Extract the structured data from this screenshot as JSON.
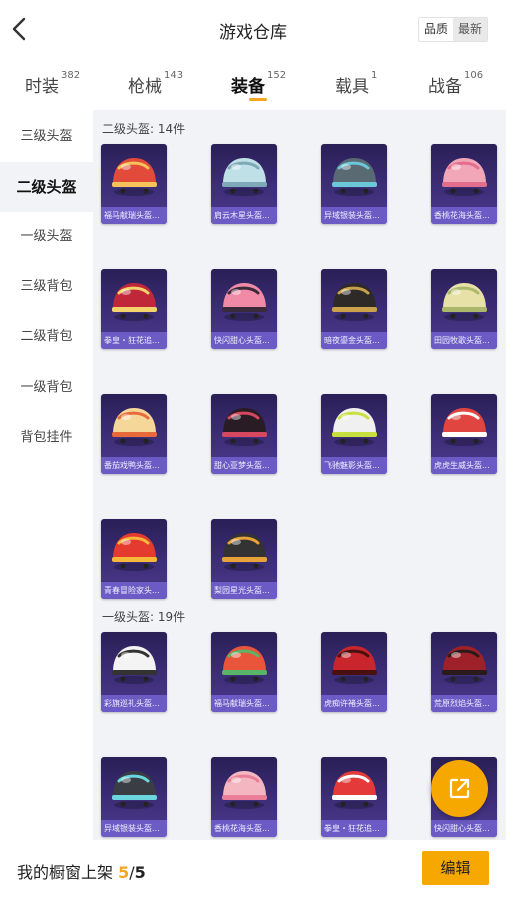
{
  "header": {
    "title": "游戏仓库",
    "sort_quality": "品质",
    "sort_newest": "最新"
  },
  "tabs": [
    {
      "label": "时装",
      "count": "382"
    },
    {
      "label": "枪械",
      "count": "143"
    },
    {
      "label": "装备",
      "count": "152"
    },
    {
      "label": "载具",
      "count": "1"
    },
    {
      "label": "战备",
      "count": "106"
    }
  ],
  "sidebar": [
    "三级头盔",
    "二级头盔",
    "一级头盔",
    "三级背包",
    "二级背包",
    "一级背包",
    "背包挂件"
  ],
  "sections": [
    {
      "title": "二级头盔: 14件",
      "items": [
        {
          "name": "福马献瑞头盔...",
          "color": "#e24a3a",
          "accent": "#f6c35b"
        },
        {
          "name": "肩云木星头盔...",
          "color": "#bfe0e6",
          "accent": "#7fa9b8"
        },
        {
          "name": "异域银装头盔...",
          "color": "#5a6a73",
          "accent": "#6cc7d8"
        },
        {
          "name": "香桃花海头盔...",
          "color": "#f2a7b8",
          "accent": "#e26d8c"
        },
        {
          "name": "拳皇・狂花追...",
          "color": "#c0283a",
          "accent": "#f3d36b"
        },
        {
          "name": "快闪甜心头盔...",
          "color": "#f08aa6",
          "accent": "#3a2a3a"
        },
        {
          "name": "暗夜鎏金头盔...",
          "color": "#2e2a28",
          "accent": "#c9a24b"
        },
        {
          "name": "田园牧歌头盔...",
          "color": "#e7e1a8",
          "accent": "#a9b86b"
        },
        {
          "name": "番茄戏鸭头盔...",
          "color": "#f6d79a",
          "accent": "#e86a3a"
        },
        {
          "name": "甜心亚梦头盔...",
          "color": "#2a1c24",
          "accent": "#d6485f"
        },
        {
          "name": "飞驰魅影头盔...",
          "color": "#f0f0f0",
          "accent": "#c7e040"
        },
        {
          "name": "虎虎生威头盔...",
          "color": "#e0453f",
          "accent": "#ffffff"
        },
        {
          "name": "青春冒险家头...",
          "color": "#e53b2f",
          "accent": "#f5b83a"
        },
        {
          "name": "梨园星光头盔...",
          "color": "#333333",
          "accent": "#e8a23a"
        }
      ]
    },
    {
      "title": "一级头盔: 19件",
      "items": [
        {
          "name": "彩旗巡礼头盔...",
          "color": "#f4f4f4",
          "accent": "#333333"
        },
        {
          "name": "福马献瑞头盔...",
          "color": "#e8553a",
          "accent": "#58b567"
        },
        {
          "name": "虎痴许褚头盔...",
          "color": "#c8262c",
          "accent": "#4a1010"
        },
        {
          "name": "荒原烈焰头盔...",
          "color": "#9e2028",
          "accent": "#2a1a1a"
        },
        {
          "name": "异域银装头盔...",
          "color": "#3a3e44",
          "accent": "#6cd6df"
        },
        {
          "name": "香桃花海头盔...",
          "color": "#f4b7c2",
          "accent": "#e97f98"
        },
        {
          "name": "拳皇・狂花追...",
          "color": "#e43a3a",
          "accent": "#ffffff"
        },
        {
          "name": "快闪甜心头盔...",
          "color": "#f1a6b3",
          "accent": "#3a2a3a"
        }
      ]
    }
  ],
  "footer": {
    "label": "我的橱窗上架 ",
    "current": "5",
    "separator": "/",
    "total": "5",
    "edit": "编辑"
  },
  "icons": {
    "back": "chevron-left-icon",
    "fab": "share-external-icon"
  },
  "colors": {
    "accent": "#f7a800",
    "card_bg": "#3d2e78",
    "card_label": "#6c5bc4",
    "panel_bg": "#f2f3f7"
  }
}
